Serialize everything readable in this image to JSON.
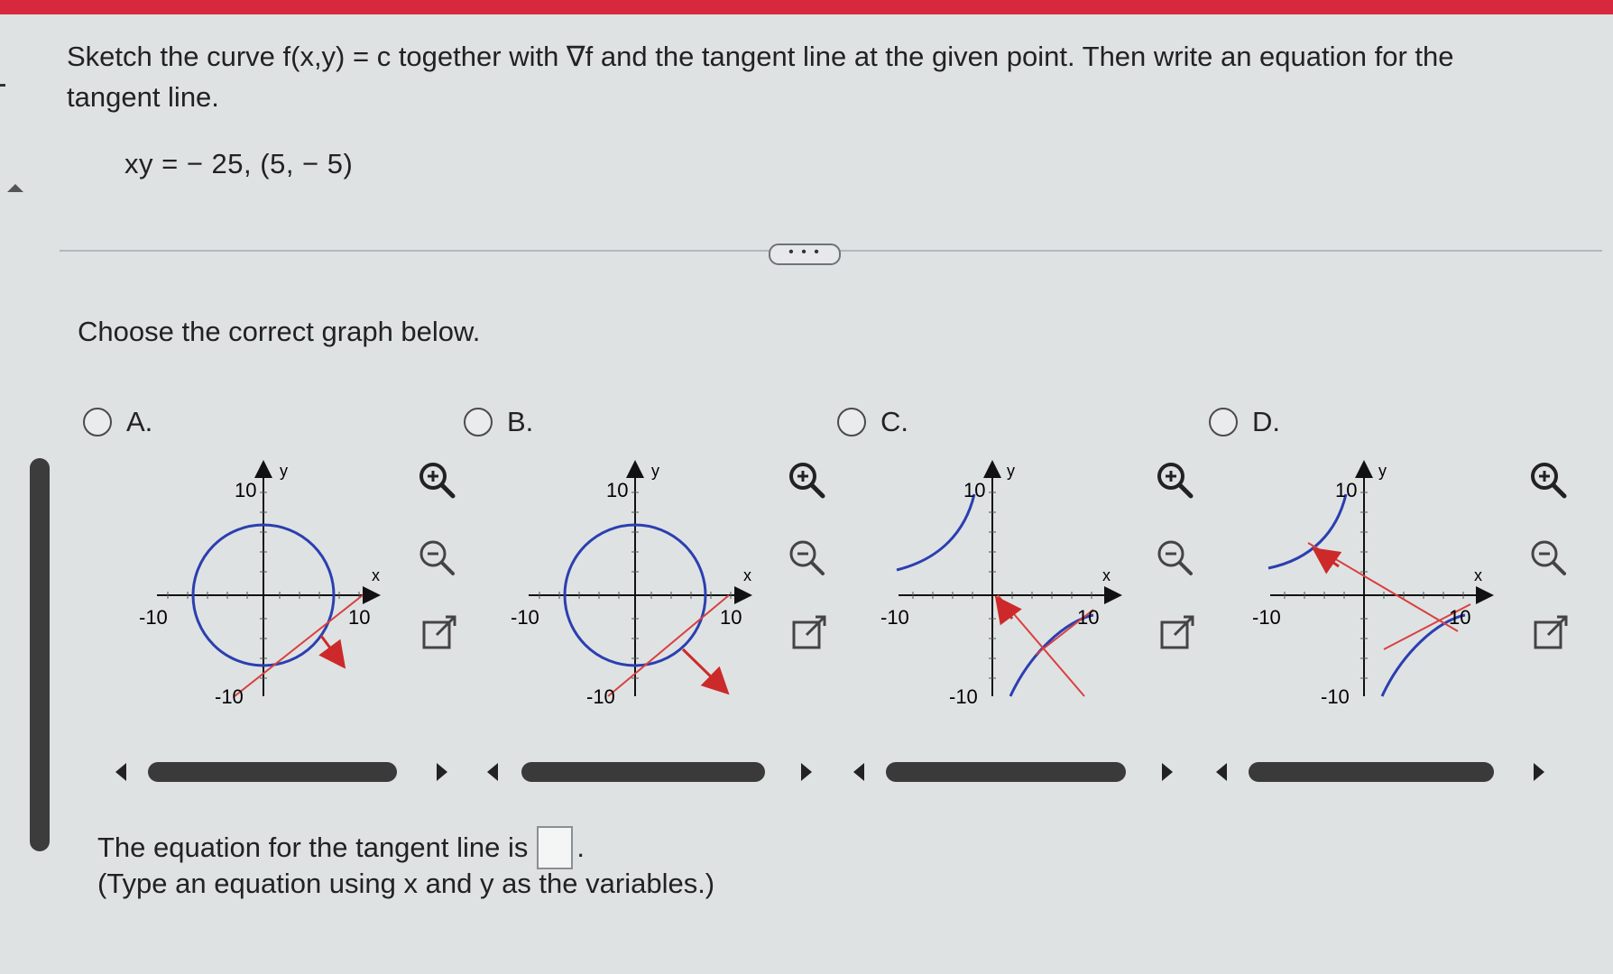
{
  "question": {
    "text": "Sketch the curve f(x,y) = c together with ∇f and the tangent line at the given point. Then write an equation for the tangent line.",
    "equation": "xy = − 25,  (5, − 5)"
  },
  "more_button_label": "• • •",
  "prompt": "Choose the correct graph below.",
  "options": [
    {
      "letter": "A.",
      "tick_min": "-10",
      "tick_max": "10",
      "axis_x": "x",
      "axis_y": "y"
    },
    {
      "letter": "B.",
      "tick_min": "-10",
      "tick_max": "10",
      "axis_x": "x",
      "axis_y": "y"
    },
    {
      "letter": "C.",
      "tick_min": "-10",
      "tick_max": "10",
      "axis_x": "x",
      "axis_y": "y"
    },
    {
      "letter": "D.",
      "tick_min": "-10",
      "tick_max": "10",
      "axis_x": "x",
      "axis_y": "y"
    }
  ],
  "tools": {
    "zoom_in": "zoom-in-icon",
    "zoom_out": "zoom-out-icon",
    "popout": "popout-icon"
  },
  "answer": {
    "prefix": "The equation for the tangent line is",
    "suffix": ".",
    "instruction": "(Type an equation using x and y as the variables.)"
  },
  "colors": {
    "curve": "#2b3fb0",
    "gradient": "#cc2a2a",
    "tangent": "#d94040",
    "accent_bar": "#d8283e"
  }
}
